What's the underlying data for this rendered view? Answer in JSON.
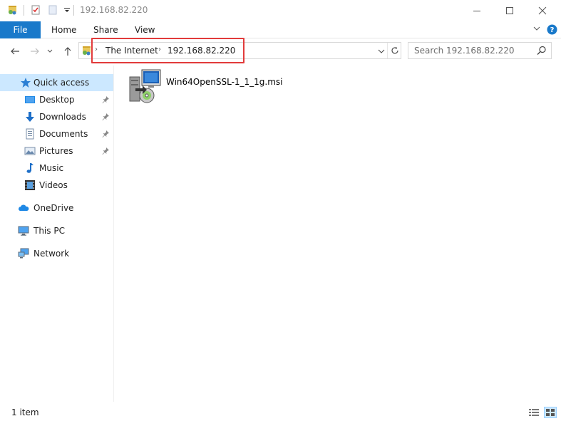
{
  "window": {
    "title": "192.168.82.220"
  },
  "ribbon": {
    "tabs": [
      {
        "label": "File"
      },
      {
        "label": "Home"
      },
      {
        "label": "Share"
      },
      {
        "label": "View"
      }
    ]
  },
  "address": {
    "crumbs": [
      "The Internet",
      "192.168.82.220"
    ]
  },
  "search": {
    "placeholder": "Search 192.168.82.220"
  },
  "nav": {
    "quick_access": "Quick access",
    "items": [
      {
        "label": "Desktop",
        "icon": "desktop-icon",
        "pinned": true
      },
      {
        "label": "Downloads",
        "icon": "download-icon",
        "pinned": true
      },
      {
        "label": "Documents",
        "icon": "documents-icon",
        "pinned": true
      },
      {
        "label": "Pictures",
        "icon": "pictures-icon",
        "pinned": true
      },
      {
        "label": "Music",
        "icon": "music-icon",
        "pinned": false
      },
      {
        "label": "Videos",
        "icon": "videos-icon",
        "pinned": false
      }
    ],
    "onedrive": "OneDrive",
    "this_pc": "This PC",
    "network": "Network"
  },
  "files": [
    {
      "name": "Win64OpenSSL-1_1_1g.msi",
      "icon": "msi-installer-icon"
    }
  ],
  "status": {
    "item_count": "1 item"
  },
  "colors": {
    "accent": "#1979ca",
    "selected": "#cce8ff",
    "highlight": "#e23b3b"
  }
}
